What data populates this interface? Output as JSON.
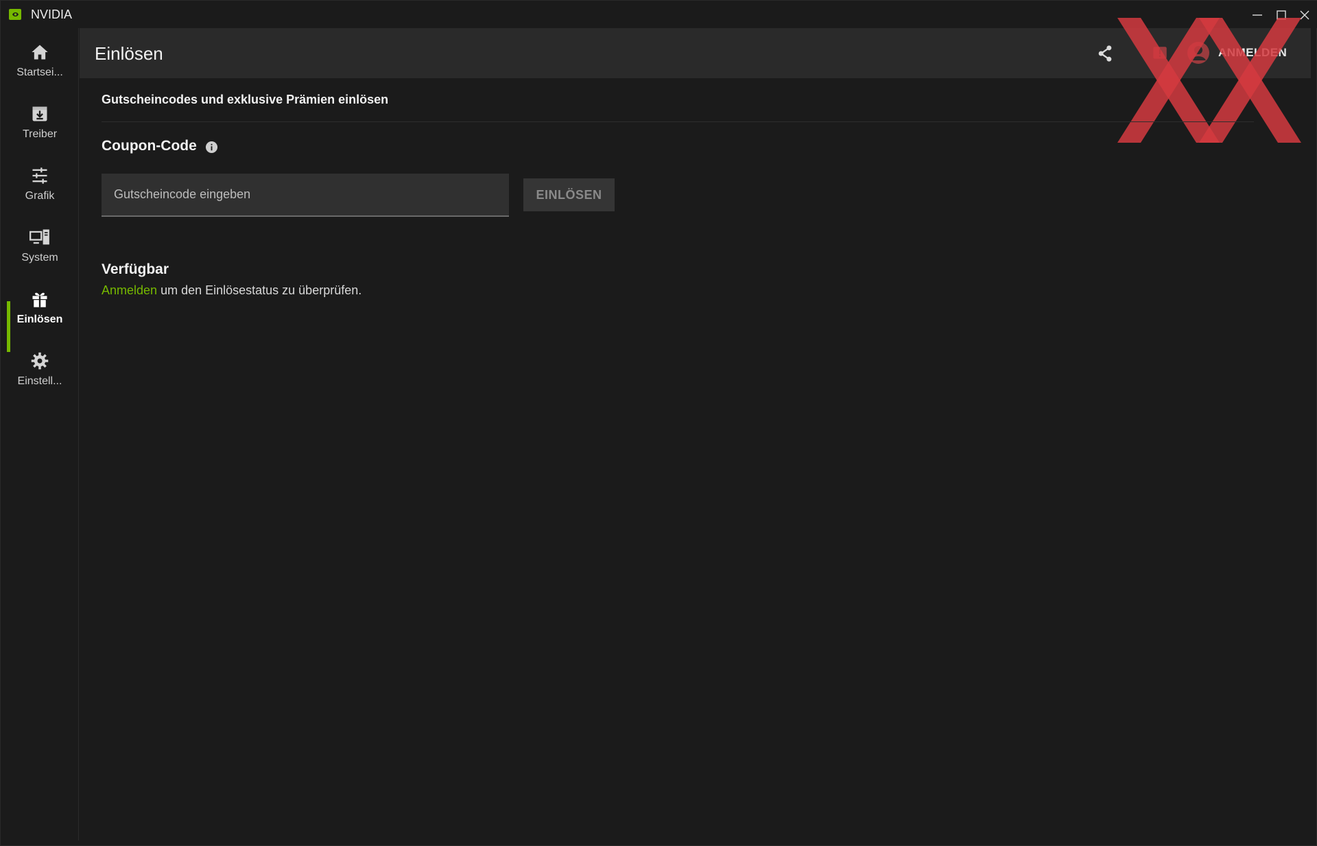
{
  "window": {
    "title": "NVIDIA",
    "controls": {
      "minimize_icon": "minimize-icon",
      "maximize_icon": "maximize-icon",
      "close_icon": "close-icon"
    }
  },
  "sidebar": {
    "items": [
      {
        "label": "Startsei...",
        "icon": "home-icon",
        "active": false
      },
      {
        "label": "Treiber",
        "icon": "driver-download-icon",
        "active": false
      },
      {
        "label": "Grafik",
        "icon": "sliders-icon",
        "active": false
      },
      {
        "label": "System",
        "icon": "system-monitor-icon",
        "active": false
      },
      {
        "label": "Einlösen",
        "icon": "gift-icon",
        "active": true
      },
      {
        "label": "Einstell...",
        "icon": "gear-icon",
        "active": false
      }
    ]
  },
  "header": {
    "title": "Einlösen",
    "login_label": "ANMELDEN"
  },
  "main": {
    "subtitle": "Gutscheincodes und exklusive Prämien einlösen",
    "coupon": {
      "title": "Coupon-Code",
      "input_value": "",
      "input_placeholder": "Gutscheincode eingeben",
      "button_label": "EINLÖSEN"
    },
    "available": {
      "title": "Verfügbar",
      "link_text": "Anmelden",
      "text": " um den Einlösestatus zu überprüfen."
    }
  },
  "colors": {
    "accent": "#76b900",
    "background": "#1b1b1b",
    "header": "#2a2a2a",
    "watermark": "#d33a40"
  }
}
